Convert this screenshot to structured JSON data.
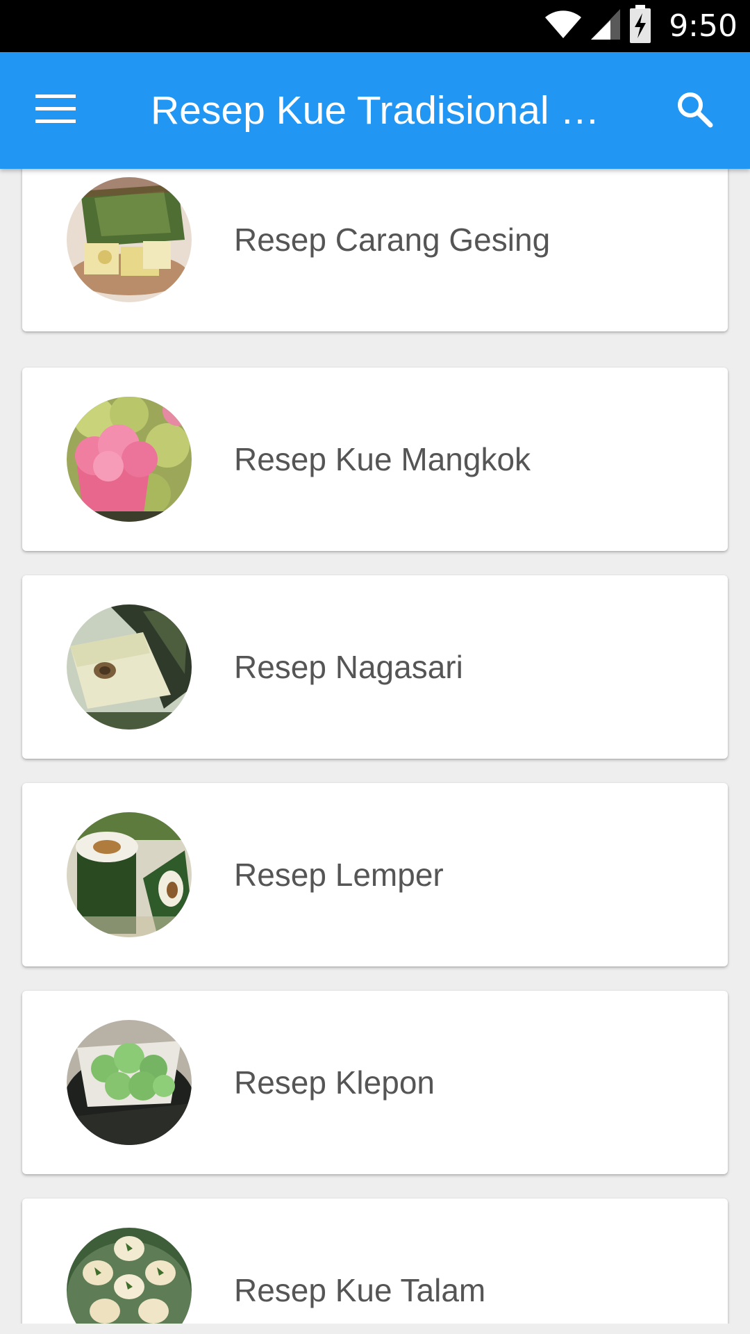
{
  "status_bar": {
    "time": "9:50",
    "icons": [
      "wifi-icon",
      "cell-signal-icon",
      "battery-charging-icon"
    ]
  },
  "app_bar": {
    "title": "Resep Kue Tradisional Indonesia",
    "menu_icon": "hamburger-menu-icon",
    "search_icon": "search-icon",
    "color": "#2196f3"
  },
  "recipes": [
    {
      "label": "Resep Carang Gesing",
      "image": "carang-gesing-thumbnail"
    },
    {
      "label": "Resep Kue Mangkok",
      "image": "kue-mangkok-thumbnail"
    },
    {
      "label": "Resep Nagasari",
      "image": "nagasari-thumbnail"
    },
    {
      "label": "Resep Lemper",
      "image": "lemper-thumbnail"
    },
    {
      "label": "Resep Klepon",
      "image": "klepon-thumbnail"
    },
    {
      "label": "Resep Kue Talam",
      "image": "kue-talam-thumbnail"
    }
  ]
}
